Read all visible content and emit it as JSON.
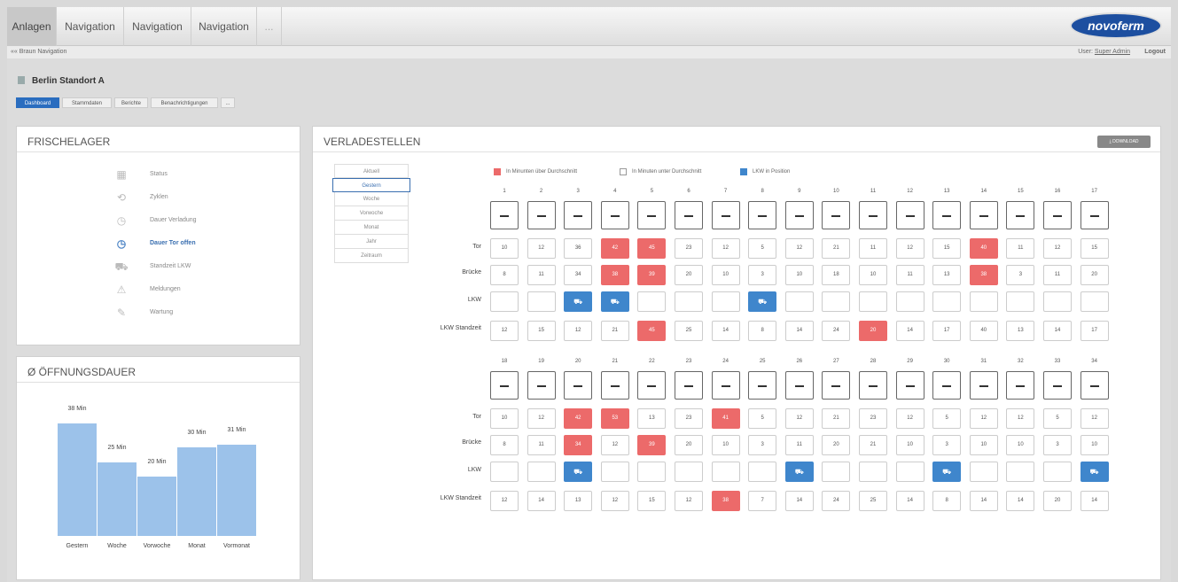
{
  "nav": {
    "tabs": [
      "Anlagen",
      "Navigation",
      "Navigation",
      "Navigation",
      "..."
    ],
    "logo": "novoferm"
  },
  "subbar": {
    "back": "«« Braun Navigation",
    "user_label": "User:",
    "user_name": "Super Admin",
    "logout": "Logout"
  },
  "page": {
    "title": "Berlin Standort A",
    "tabs": [
      "Dashboard",
      "Stammdaten",
      "Berichte",
      "Benachrichtigungen",
      "..."
    ]
  },
  "frischelager": {
    "title": "FRISCHELAGER",
    "items": [
      {
        "label": "Status",
        "icon": "status-icon",
        "glyph": "▦",
        "active": false
      },
      {
        "label": "Zyklen",
        "icon": "cycles-icon",
        "glyph": "⟲",
        "active": false
      },
      {
        "label": "Dauer Verladung",
        "icon": "clock-icon",
        "glyph": "◷",
        "active": false
      },
      {
        "label": "Dauer Tor offen",
        "icon": "clock-icon",
        "glyph": "◷",
        "active": true
      },
      {
        "label": "Standzeit LKW",
        "icon": "truck-icon",
        "glyph": "⛟",
        "active": false
      },
      {
        "label": "Meldungen",
        "icon": "warning-icon",
        "glyph": "⚠",
        "active": false
      },
      {
        "label": "Wartung",
        "icon": "wrench-icon",
        "glyph": "✎",
        "active": false
      }
    ]
  },
  "oeffnung": {
    "title": "Ø ÖFFNUNGSDAUER",
    "chart_data": {
      "type": "bar",
      "categories": [
        "Gestern",
        "Woche",
        "Vorwoche",
        "Monat",
        "Vormonat"
      ],
      "values": [
        38,
        25,
        20,
        30,
        31
      ],
      "value_labels": [
        "38 Min",
        "25 Min",
        "20 Min",
        "30 Min",
        "31 Min"
      ],
      "ylim": [
        0,
        45
      ],
      "color": "#9cc2ea"
    }
  },
  "verladestellen": {
    "title": "VERLADESTELLEN",
    "download": "⤓ DOWNLOAD",
    "periods": [
      "Aktuell",
      "Gestern",
      "Woche",
      "Vorwoche",
      "Monat",
      "Jahr",
      "Zeitraum"
    ],
    "active_period": 1,
    "legend": [
      {
        "label": "In Minunten über Durchschnitt",
        "color": "#ec6a6a"
      },
      {
        "label": "In Minuten unter Durchschnitt",
        "color": "#ffffff"
      },
      {
        "label": "LKW in Position",
        "color": "#3f86cc"
      }
    ],
    "row_labels": [
      "Tor",
      "Brücke",
      "LKW",
      "LKW Standzeit"
    ],
    "truck_glyph": "⛟",
    "blocks": [
      {
        "cols": [
          "1",
          "2",
          "3",
          "4",
          "5",
          "6",
          "7",
          "8",
          "9",
          "10",
          "11",
          "12",
          "13",
          "14",
          "15",
          "16",
          "17"
        ],
        "tor": [
          "10",
          "12",
          "36",
          "42",
          "45",
          "23",
          "12",
          "5",
          "12",
          "21",
          "11",
          "12",
          "15",
          "40",
          "11",
          "12",
          "15"
        ],
        "tor_hot": [
          3,
          4,
          13
        ],
        "bruecke": [
          "8",
          "11",
          "34",
          "38",
          "39",
          "20",
          "10",
          "3",
          "10",
          "18",
          "10",
          "11",
          "13",
          "38",
          "3",
          "11",
          "20"
        ],
        "bruecke_hot": [
          3,
          4,
          13
        ],
        "lkw": [
          2,
          3,
          7
        ],
        "standzeit": [
          "12",
          "15",
          "12",
          "21",
          "45",
          "25",
          "14",
          "8",
          "14",
          "24",
          "20",
          "14",
          "17",
          "40",
          "13",
          "14",
          "17"
        ],
        "standzeit_hot": [
          4,
          10
        ]
      },
      {
        "cols": [
          "18",
          "19",
          "20",
          "21",
          "22",
          "23",
          "24",
          "25",
          "26",
          "27",
          "28",
          "29",
          "30",
          "31",
          "32",
          "33",
          "34"
        ],
        "tor": [
          "10",
          "12",
          "42",
          "53",
          "13",
          "23",
          "41",
          "5",
          "12",
          "21",
          "23",
          "12",
          "5",
          "12",
          "12",
          "5",
          "12"
        ],
        "tor_hot": [
          2,
          3,
          6
        ],
        "bruecke": [
          "8",
          "11",
          "34",
          "12",
          "39",
          "20",
          "10",
          "3",
          "11",
          "20",
          "21",
          "10",
          "3",
          "10",
          "10",
          "3",
          "10"
        ],
        "bruecke_hot": [
          2,
          4
        ],
        "lkw": [
          2,
          8,
          12,
          16
        ],
        "standzeit": [
          "12",
          "14",
          "13",
          "12",
          "15",
          "12",
          "38",
          "7",
          "14",
          "24",
          "25",
          "14",
          "8",
          "14",
          "14",
          "20",
          "14"
        ],
        "standzeit_hot": [
          6
        ]
      }
    ]
  }
}
